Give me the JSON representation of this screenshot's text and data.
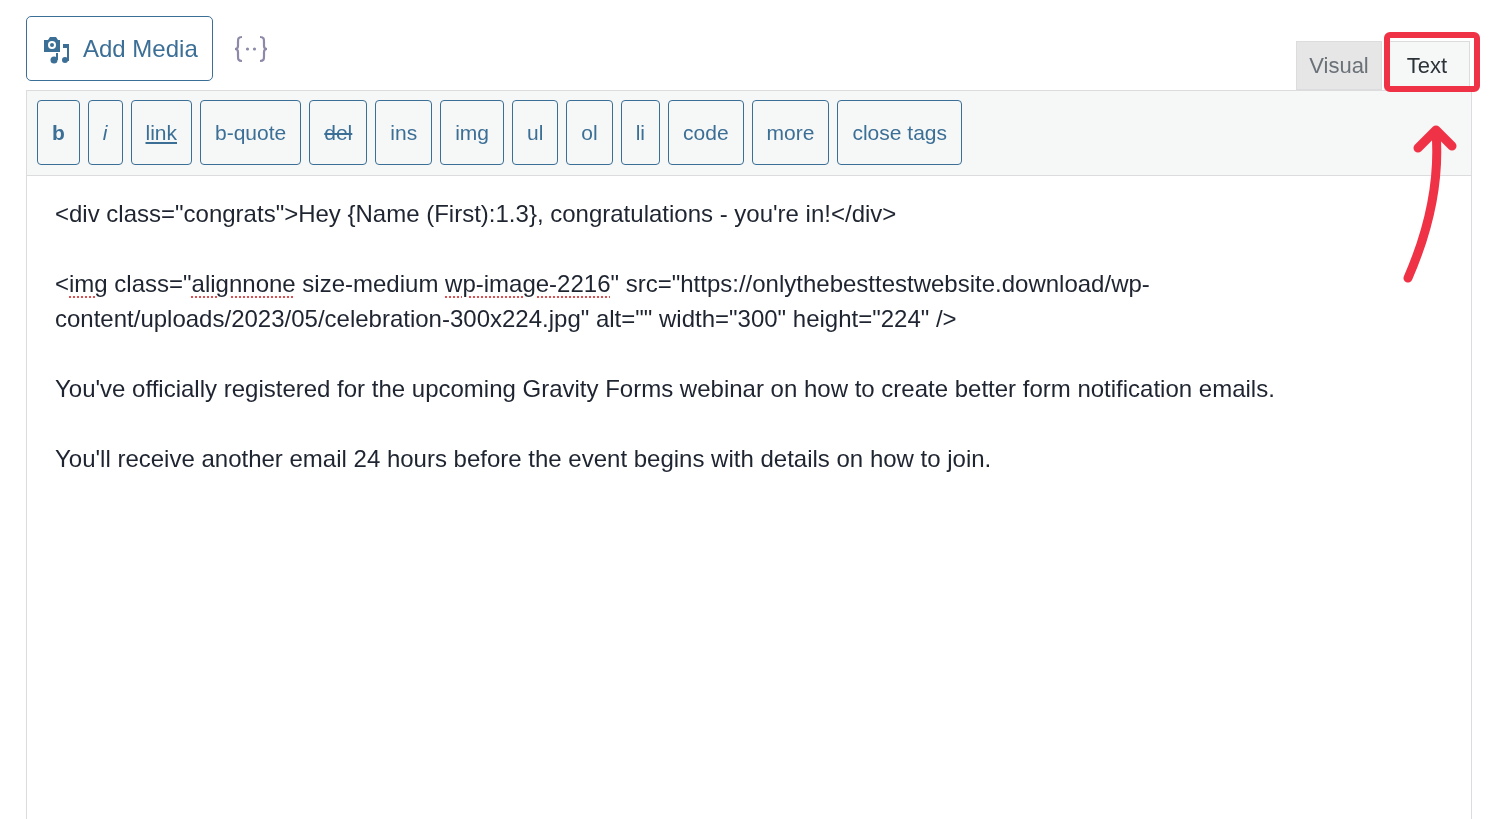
{
  "media_button": {
    "label": "Add Media"
  },
  "tabs": [
    {
      "label": "Visual",
      "selected": false
    },
    {
      "label": "Text",
      "selected": true
    }
  ],
  "toolbar": [
    {
      "label": "b",
      "kind": "bold"
    },
    {
      "label": "i",
      "kind": "italic"
    },
    {
      "label": "link",
      "kind": "underline"
    },
    {
      "label": "b-quote",
      "kind": "plain"
    },
    {
      "label": "del",
      "kind": "strike"
    },
    {
      "label": "ins",
      "kind": "plain"
    },
    {
      "label": "img",
      "kind": "plain"
    },
    {
      "label": "ul",
      "kind": "plain"
    },
    {
      "label": "ol",
      "kind": "plain"
    },
    {
      "label": "li",
      "kind": "plain"
    },
    {
      "label": "code",
      "kind": "plain"
    },
    {
      "label": "more",
      "kind": "plain"
    },
    {
      "label": "close tags",
      "kind": "plain"
    }
  ],
  "content": [
    [
      {
        "text": "<div class=\"congrats\">Hey {Name (First):1.3}, congratulations - you're in!</div>",
        "misspelled": false
      }
    ],
    [
      {
        "text": "<",
        "misspelled": false
      },
      {
        "text": "img",
        "misspelled": true
      },
      {
        "text": " class=\"",
        "misspelled": false
      },
      {
        "text": "alignnone",
        "misspelled": true
      },
      {
        "text": " size-medium ",
        "misspelled": false
      },
      {
        "text": "wp-image-2216",
        "misspelled": true
      },
      {
        "text": "\" src=\"https://onlythebesttestwebsite.download/wp-content/uploads/2023/05/celebration-300x224.jpg\" alt=\"\" width=\"300\" height=\"224\" />",
        "misspelled": false
      }
    ],
    [
      {
        "text": "You've officially registered for the upcoming Gravity Forms webinar on how to create better form notification emails.",
        "misspelled": false
      }
    ],
    [
      {
        "text": "You'll receive another email 24 hours before the event begins with details on how to join.",
        "misspelled": false
      }
    ]
  ]
}
